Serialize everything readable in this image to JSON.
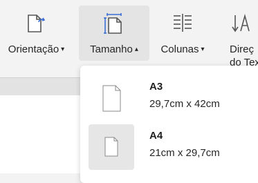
{
  "ribbon": {
    "orientation": {
      "label": "Orientação",
      "icon": "orientation-icon"
    },
    "size": {
      "label": "Tamanho",
      "icon": "page-size-icon",
      "caret": "up"
    },
    "columns": {
      "label": "Colunas",
      "icon": "columns-icon"
    },
    "direction": {
      "label_line1": "Direç",
      "label_line2": "do Tex",
      "icon": "text-direction-icon"
    }
  },
  "size_menu": {
    "options": [
      {
        "name": "A3",
        "dimensions": "29,7cm x 42cm",
        "selected": false
      },
      {
        "name": "A4",
        "dimensions": "21cm x 29,7cm",
        "selected": true
      }
    ]
  },
  "colors": {
    "accent": "#3b6fd4",
    "icon_gray": "#555555"
  }
}
